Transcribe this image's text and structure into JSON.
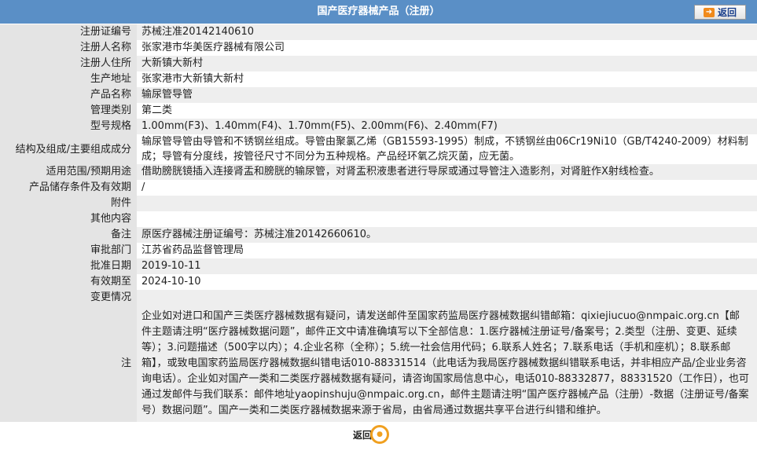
{
  "header": {
    "title": "国产医疗器械产品（注册）",
    "back_label": "返回"
  },
  "rows": [
    {
      "label": "注册证编号",
      "value": "苏械注准20142140610"
    },
    {
      "label": "注册人名称",
      "value": "张家港市华美医疗器械有限公司"
    },
    {
      "label": "注册人住所",
      "value": "大新镇大新村"
    },
    {
      "label": "生产地址",
      "value": "张家港市大新镇大新村"
    },
    {
      "label": "产品名称",
      "value": "输尿管导管"
    },
    {
      "label": "管理类别",
      "value": "第二类"
    },
    {
      "label": "型号规格",
      "value": "1.00mm(F3)、1.40mm(F4)、1.70mm(F5)、2.00mm(F6)、2.40mm(F7)"
    },
    {
      "label": "结构及组成/主要组成成分",
      "value": "输尿管导管由导管和不锈钢丝组成。导管由聚氯乙烯（GB15593-1995）制成，不锈钢丝由06Cr19Ni10（GB/T4240-2009）材料制成；导管有分度线，按管径尺寸不同分为五种规格。产品经环氧乙烷灭菌，应无菌。"
    },
    {
      "label": "适用范围/预期用途",
      "value": "借助膀胱镜插入连接肾盂和膀胱的输尿管，对肾盂积液患者进行导尿或通过导管注入造影剂，对肾脏作X射线检查。"
    },
    {
      "label": "产品储存条件及有效期",
      "value": "/"
    },
    {
      "label": "附件",
      "value": ""
    },
    {
      "label": "其他内容",
      "value": ""
    },
    {
      "label": "备注",
      "value": "原医疗器械注册证编号：苏械注准20142660610。"
    },
    {
      "label": "审批部门",
      "value": "江苏省药品监督管理局"
    },
    {
      "label": "批准日期",
      "value": "2019-10-11"
    },
    {
      "label": "有效期至",
      "value": "2024-10-10"
    },
    {
      "label": "变更情况",
      "value": ""
    }
  ],
  "note": {
    "label": "注",
    "text": "企业如对进口和国产三类医疗器械数据有疑问，请发送邮件至国家药监局医疗器械数据纠错邮箱：qixiejiucuo@nmpaic.org.cn【邮件主题请注明“医疗器械数据问题”，邮件正文中请准确填写以下全部信息：1.医疗器械注册证号/备案号；2.类型（注册、变更、延续等）；3.问题描述（500字以内）；4.企业名称（全称）；5.统一社会信用代码；6.联系人姓名；7.联系电话（手机和座机）；8.联系邮箱】，或致电国家药监局医疗器械数据纠错电话010-88331514（此电话为我局医疗器械数据纠错联系电话，并非相应产品/企业业务咨询电话）。企业如对国产一类和二类医疗器械数据有疑问，请咨询国家局信息中心，电话010-88332877，88331520（工作日），也可通过发邮件与我们联系：邮件地址yaopinshuju@nmpaic.org.cn，邮件主题请注明“国产医疗器械产品（注册）-数据（注册证号/备案号）数据问题”。国产一类和二类医疗器械数据来源于省局，由省局通过数据共享平台进行纠错和维护。"
  },
  "footer": {
    "back_label": "返回"
  },
  "colors": {
    "header_bg": "#5a8fc6",
    "label_bg": "#e4e4e4",
    "stripe_bg": "#eeeeee",
    "accent": "#f0a020"
  }
}
